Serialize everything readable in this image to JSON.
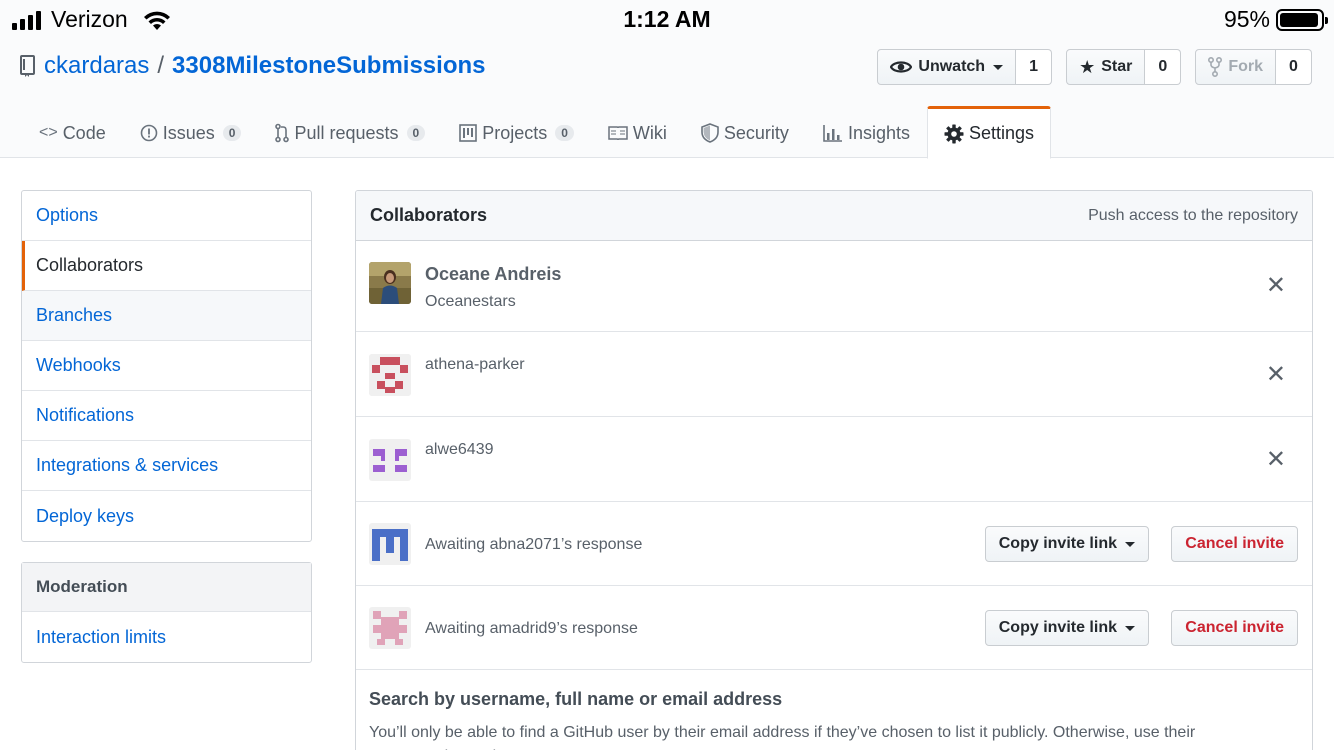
{
  "status_bar": {
    "carrier": "Verizon",
    "time": "1:12 AM",
    "battery": "95%",
    "battery_level": 0.95
  },
  "repo": {
    "owner": "ckardaras",
    "separator": "/",
    "name": "3308MilestoneSubmissions"
  },
  "actions": {
    "watch": {
      "label": "Unwatch",
      "count": "1"
    },
    "star": {
      "label": "Star",
      "count": "0"
    },
    "fork": {
      "label": "Fork",
      "count": "0"
    }
  },
  "tabs": [
    {
      "label": "Code",
      "icon": "code-icon"
    },
    {
      "label": "Issues",
      "count": "0",
      "icon": "issue-icon"
    },
    {
      "label": "Pull requests",
      "count": "0",
      "icon": "pull-request-icon"
    },
    {
      "label": "Projects",
      "count": "0",
      "icon": "project-icon"
    },
    {
      "label": "Wiki",
      "icon": "book-icon"
    },
    {
      "label": "Security",
      "icon": "shield-icon"
    },
    {
      "label": "Insights",
      "icon": "graph-icon"
    },
    {
      "label": "Settings",
      "icon": "gear-icon",
      "active": true
    }
  ],
  "sidebar": {
    "items": [
      "Options",
      "Collaborators",
      "Branches",
      "Webhooks",
      "Notifications",
      "Integrations & services",
      "Deploy keys"
    ],
    "selected": "Collaborators",
    "moderation_heading": "Moderation",
    "moderation_items": [
      "Interaction limits"
    ]
  },
  "collaborators": {
    "title": "Collaborators",
    "note": "Push access to the repository",
    "members": [
      {
        "name": "Oceane Andreis",
        "login": "Oceanestars"
      },
      {
        "login": "athena-parker"
      },
      {
        "login": "alwe6439"
      }
    ],
    "pending": [
      {
        "text": "Awaiting abna2071’s response"
      },
      {
        "text": "Awaiting amadrid9’s response"
      }
    ],
    "copy_label": "Copy invite link",
    "cancel_label": "Cancel invite",
    "search_title": "Search by username, full name or email address",
    "search_help": "You’ll only be able to find a GitHub user by their email address if they’ve chosen to list it publicly. Otherwise, use their username instead."
  },
  "colors": {
    "link": "#0366d6",
    "accent": "#e36209",
    "danger": "#cb2431"
  }
}
